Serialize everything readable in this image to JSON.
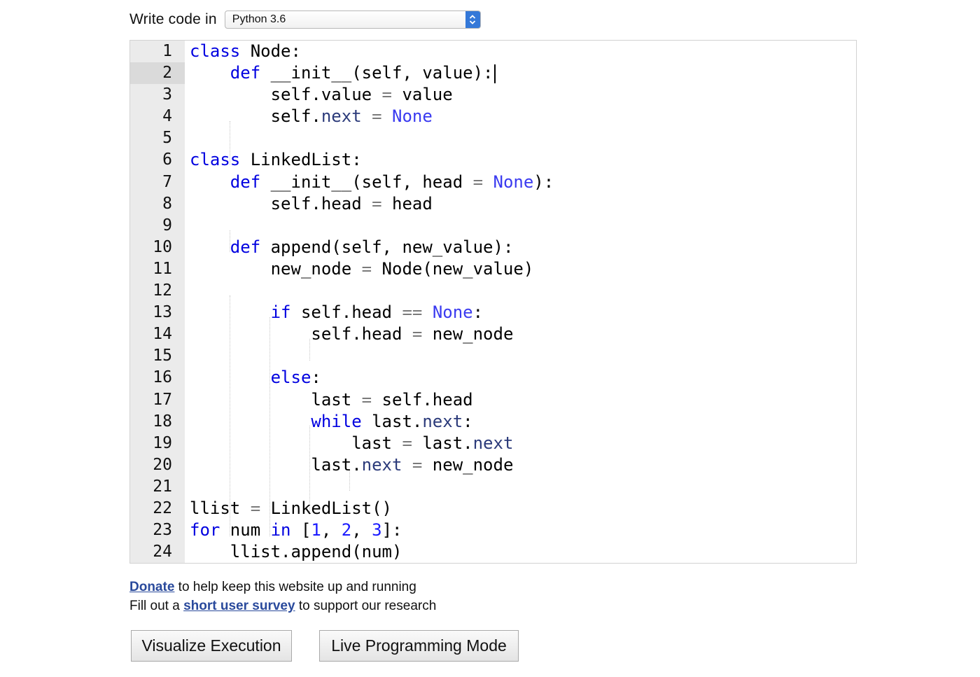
{
  "language_selector": {
    "label": "Write code in",
    "selected": "Python 3.6"
  },
  "editor": {
    "active_line": 2,
    "line_numbers": [
      "1",
      "2",
      "3",
      "4",
      "5",
      "6",
      "7",
      "8",
      "9",
      "10",
      "11",
      "12",
      "13",
      "14",
      "15",
      "16",
      "17",
      "18",
      "19",
      "20",
      "21",
      "22",
      "23",
      "24"
    ],
    "code_lines": [
      "class Node:",
      "    def __init__(self, value):",
      "        self.value = value",
      "        self.next = None",
      "",
      "class LinkedList:",
      "    def __init__(self, head = None):",
      "        self.head = head",
      "",
      "    def append(self, new_value):",
      "        new_node = Node(new_value)",
      "",
      "        if self.head == None:",
      "            self.head = new_node",
      "",
      "        else:",
      "            last = self.head",
      "            while last.next:",
      "                last = last.next",
      "            last.next = new_node",
      "",
      "llist = LinkedList()",
      "for num in [1, 2, 3]:",
      "    llist.append(num)"
    ]
  },
  "footer": {
    "donate_link": "Donate",
    "donate_text": " to help keep this website up and running",
    "survey_prefix": "Fill out a ",
    "survey_link": "short user survey",
    "survey_suffix": " to support our research"
  },
  "buttons": {
    "visualize": "Visualize Execution",
    "live": "Live Programming Mode"
  },
  "colors": {
    "keyword": "#0000e0",
    "constant": "#3a3af0",
    "link": "#2a4a9c",
    "gutter_bg": "#ebebeb",
    "select_arrow_bg": "#3478d8"
  }
}
